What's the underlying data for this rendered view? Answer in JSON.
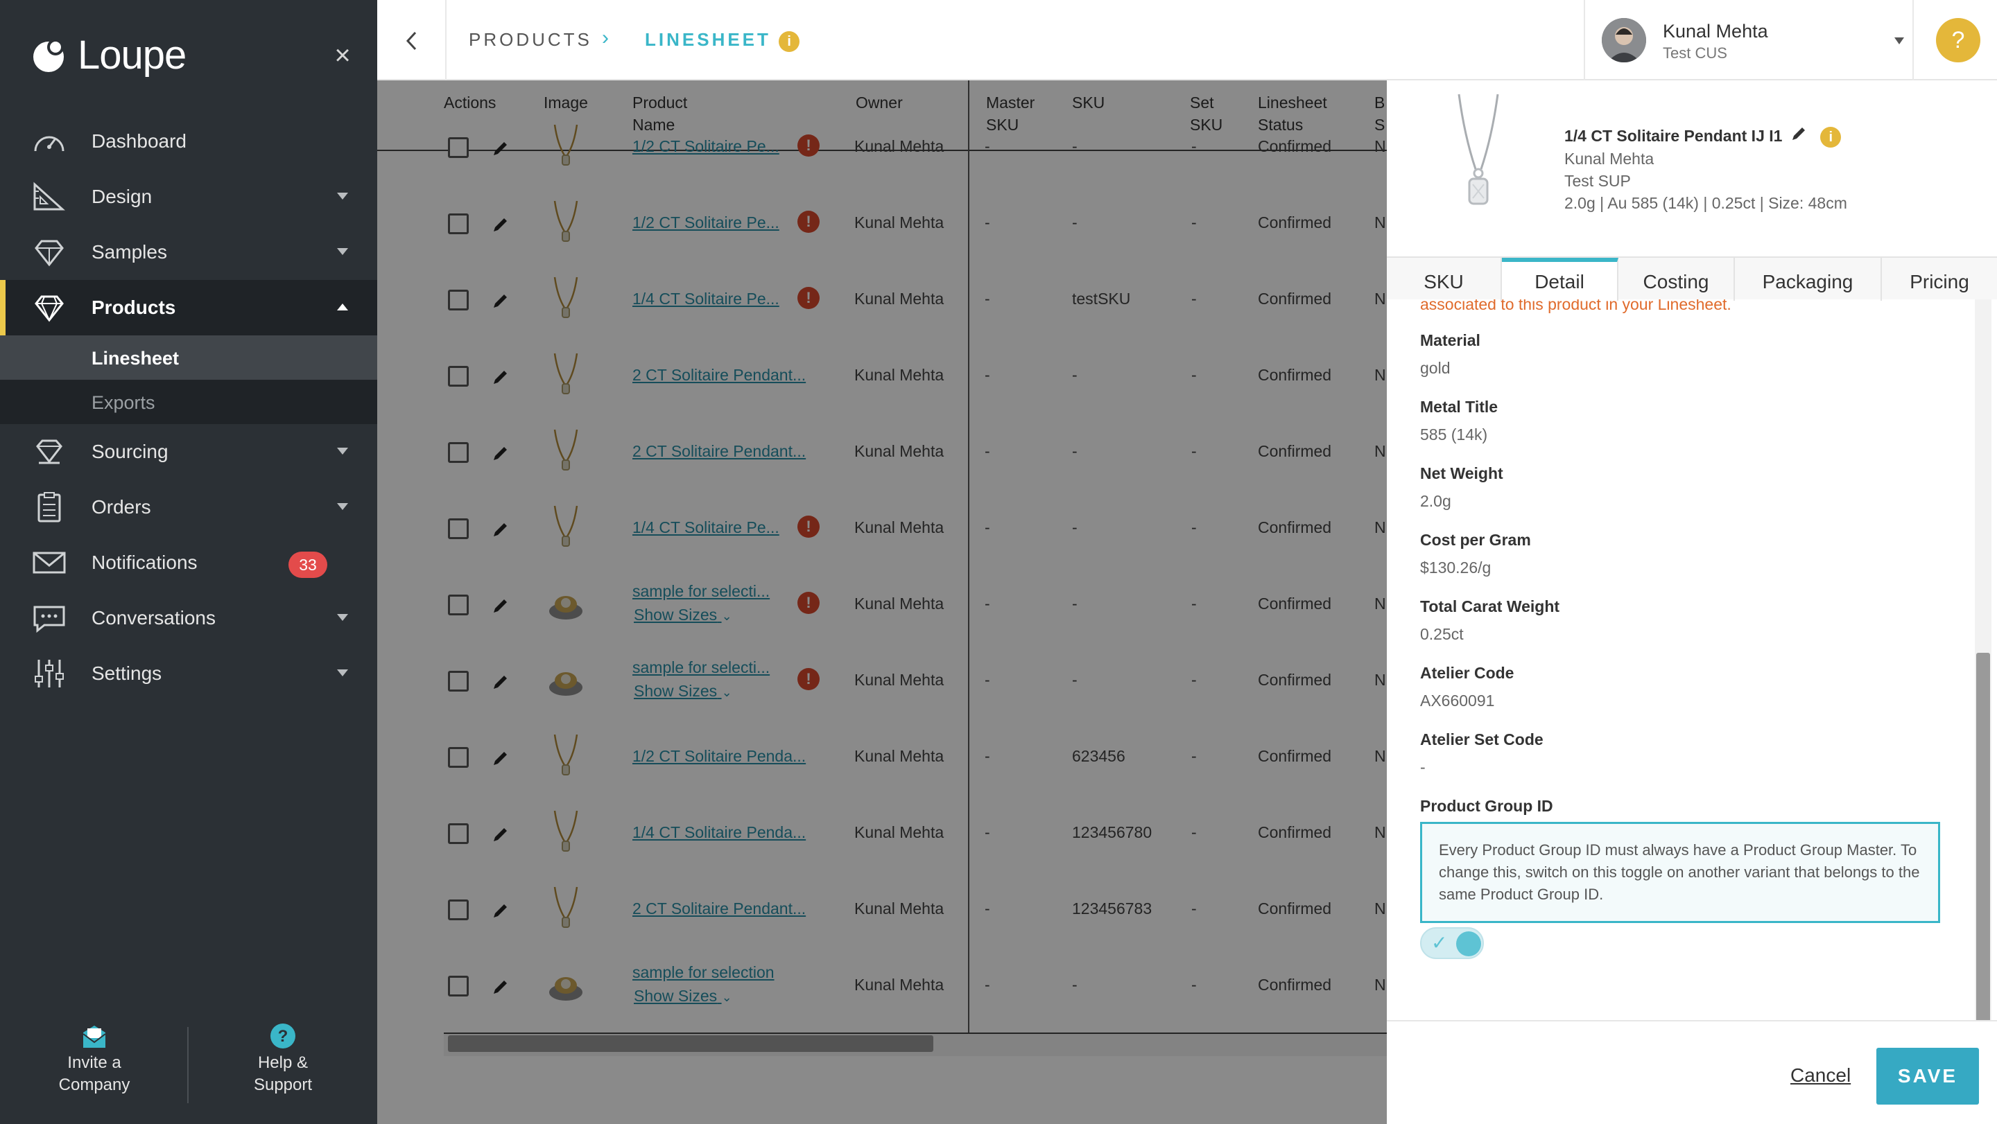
{
  "sidebar": {
    "logo": "Loupe",
    "items": [
      {
        "label": "Dashboard"
      },
      {
        "label": "Design"
      },
      {
        "label": "Samples"
      },
      {
        "label": "Products"
      },
      {
        "label": "Sourcing"
      },
      {
        "label": "Orders"
      },
      {
        "label": "Notifications",
        "badge": "33"
      },
      {
        "label": "Conversations"
      },
      {
        "label": "Settings"
      }
    ],
    "sub_items": [
      {
        "label": "Linesheet"
      },
      {
        "label": "Exports"
      }
    ],
    "bottom": {
      "invite_line1": "Invite a",
      "invite_line2": "Company",
      "help_line1": "Help &",
      "help_line2": "Support"
    }
  },
  "topbar": {
    "crumb1": "PRODUCTS",
    "crumb_sep": "›",
    "crumb2": "LINESHEET",
    "info": "i",
    "user_name": "Kunal Mehta",
    "user_org": "Test CUS",
    "help": "?"
  },
  "table": {
    "headers": {
      "actions": "Actions",
      "image": "Image",
      "product_name_1": "Product",
      "product_name_2": "Name",
      "owner": "Owner",
      "master_sku_1": "Master",
      "master_sku_2": "SKU",
      "sku": "SKU",
      "set_sku_1": "Set",
      "set_sku_2": "SKU",
      "status_1": "Linesheet",
      "status_2": "Status",
      "b_1": "B",
      "b_2": "S"
    },
    "rows": [
      {
        "name": "1/2 CT Solitaire Pe...",
        "warn": true,
        "owner": "Kunal Mehta",
        "master": "-",
        "sku": "-",
        "set": "-",
        "status": "Confirmed",
        "b": "N"
      },
      {
        "name": "1/2 CT Solitaire Pe...",
        "warn": true,
        "owner": "Kunal Mehta",
        "master": "-",
        "sku": "-",
        "set": "-",
        "status": "Confirmed",
        "b": "N"
      },
      {
        "name": "1/4 CT Solitaire Pe...",
        "warn": true,
        "owner": "Kunal Mehta",
        "master": "-",
        "sku": "testSKU",
        "set": "-",
        "status": "Confirmed",
        "b": "N"
      },
      {
        "name": "2 CT Solitaire Pendant...",
        "warn": false,
        "owner": "Kunal Mehta",
        "master": "-",
        "sku": "-",
        "set": "-",
        "status": "Confirmed",
        "b": "N"
      },
      {
        "name": "2 CT Solitaire Pendant...",
        "warn": false,
        "owner": "Kunal Mehta",
        "master": "-",
        "sku": "-",
        "set": "-",
        "status": "Confirmed",
        "b": "N"
      },
      {
        "name": "1/4 CT Solitaire Pe...",
        "warn": true,
        "owner": "Kunal Mehta",
        "master": "-",
        "sku": "-",
        "set": "-",
        "status": "Confirmed",
        "b": "N"
      },
      {
        "name": "sample for selecti...",
        "show_sizes": "Show Sizes",
        "warn": true,
        "owner": "Kunal Mehta",
        "master": "-",
        "sku": "-",
        "set": "-",
        "status": "Confirmed",
        "b": "N"
      },
      {
        "name": "sample for selecti...",
        "show_sizes": "Show Sizes",
        "warn": true,
        "owner": "Kunal Mehta",
        "master": "-",
        "sku": "-",
        "set": "-",
        "status": "Confirmed",
        "b": "N"
      },
      {
        "name": "1/2 CT Solitaire Penda...",
        "warn": false,
        "owner": "Kunal Mehta",
        "master": "-",
        "sku": "623456",
        "set": "-",
        "status": "Confirmed",
        "b": "N"
      },
      {
        "name": "1/4 CT Solitaire Penda...",
        "warn": false,
        "owner": "Kunal Mehta",
        "master": "-",
        "sku": "123456780",
        "set": "-",
        "status": "Confirmed",
        "b": "N"
      },
      {
        "name": "2 CT Solitaire Pendant...",
        "warn": false,
        "owner": "Kunal Mehta",
        "master": "-",
        "sku": "123456783",
        "set": "-",
        "status": "Confirmed",
        "b": "N"
      },
      {
        "name": "sample for selection",
        "show_sizes": "Show Sizes",
        "warn": false,
        "owner": "Kunal Mehta",
        "master": "-",
        "sku": "-",
        "set": "-",
        "status": "Confirmed",
        "b": "N"
      }
    ]
  },
  "panel": {
    "title": "1/4 CT Solitaire Pendant IJ I1",
    "info": "i",
    "owner": "Kunal Mehta",
    "supplier": "Test SUP",
    "specs": "2.0g | Au 585 (14k) | 0.25ct | Size: 48cm",
    "tabs": [
      {
        "label": "SKU"
      },
      {
        "label": "Detail"
      },
      {
        "label": "Costing"
      },
      {
        "label": "Packaging"
      },
      {
        "label": "Pricing"
      }
    ],
    "note": "associated to this product in your Linesheet.",
    "fields": [
      {
        "label": "Material",
        "value": "gold"
      },
      {
        "label": "Metal Title",
        "value": "585 (14k)"
      },
      {
        "label": "Net Weight",
        "value": "2.0g"
      },
      {
        "label": "Cost per Gram",
        "value": "$130.26/g"
      },
      {
        "label": "Total Carat Weight",
        "value": "0.25ct"
      },
      {
        "label": "Atelier Code",
        "value": "AX660091"
      },
      {
        "label": "Atelier Set Code",
        "value": "-"
      },
      {
        "label": "Product Group ID",
        "value": ""
      }
    ],
    "callout": "Every Product Group ID must always have a Product Group Master. To change this, switch on this toggle on another variant that belongs to the same Product Group ID.",
    "toggle_on": true,
    "cancel_label": "Cancel",
    "save_label": "SAVE"
  },
  "colors": {
    "accent": "#3ab6c8",
    "warning": "#d9492e",
    "info": "#e4b73a",
    "sidebar": "#2b3035",
    "badge": "#e34b4b",
    "note": "#e06b2c"
  }
}
